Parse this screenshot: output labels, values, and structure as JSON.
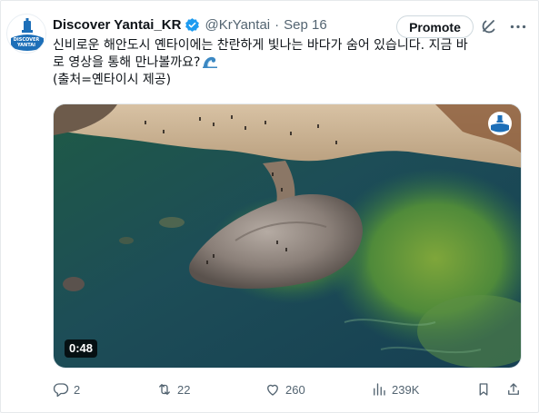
{
  "account": {
    "display_name": "Discover Yantai_KR",
    "handle": "@KrYantai",
    "date": "Sep 16",
    "avatar_text_top": "DISCOVER",
    "avatar_text_bottom": "YANTAI",
    "verified_color": "#1d9bf0"
  },
  "header": {
    "promote_label": "Promote",
    "separator": "·"
  },
  "tweet": {
    "line1": "신비로운 해안도시 옌타이에는 찬란하게 빛나는 바다가 숨어 있습니다. 지금 바",
    "line2": "로 영상을 통해 만나볼까요?",
    "line3": "(출처=옌타이시 제공)",
    "emoji": "water-wave-emoji"
  },
  "video": {
    "duration": "0:48",
    "logo_icon": "discover-yantai-logo-icon"
  },
  "actions": {
    "replies": "2",
    "reposts": "22",
    "likes": "260",
    "views": "239K"
  },
  "colors": {
    "text": "#0f1419",
    "secondary": "#536471",
    "brand": "#1d6fb8"
  }
}
